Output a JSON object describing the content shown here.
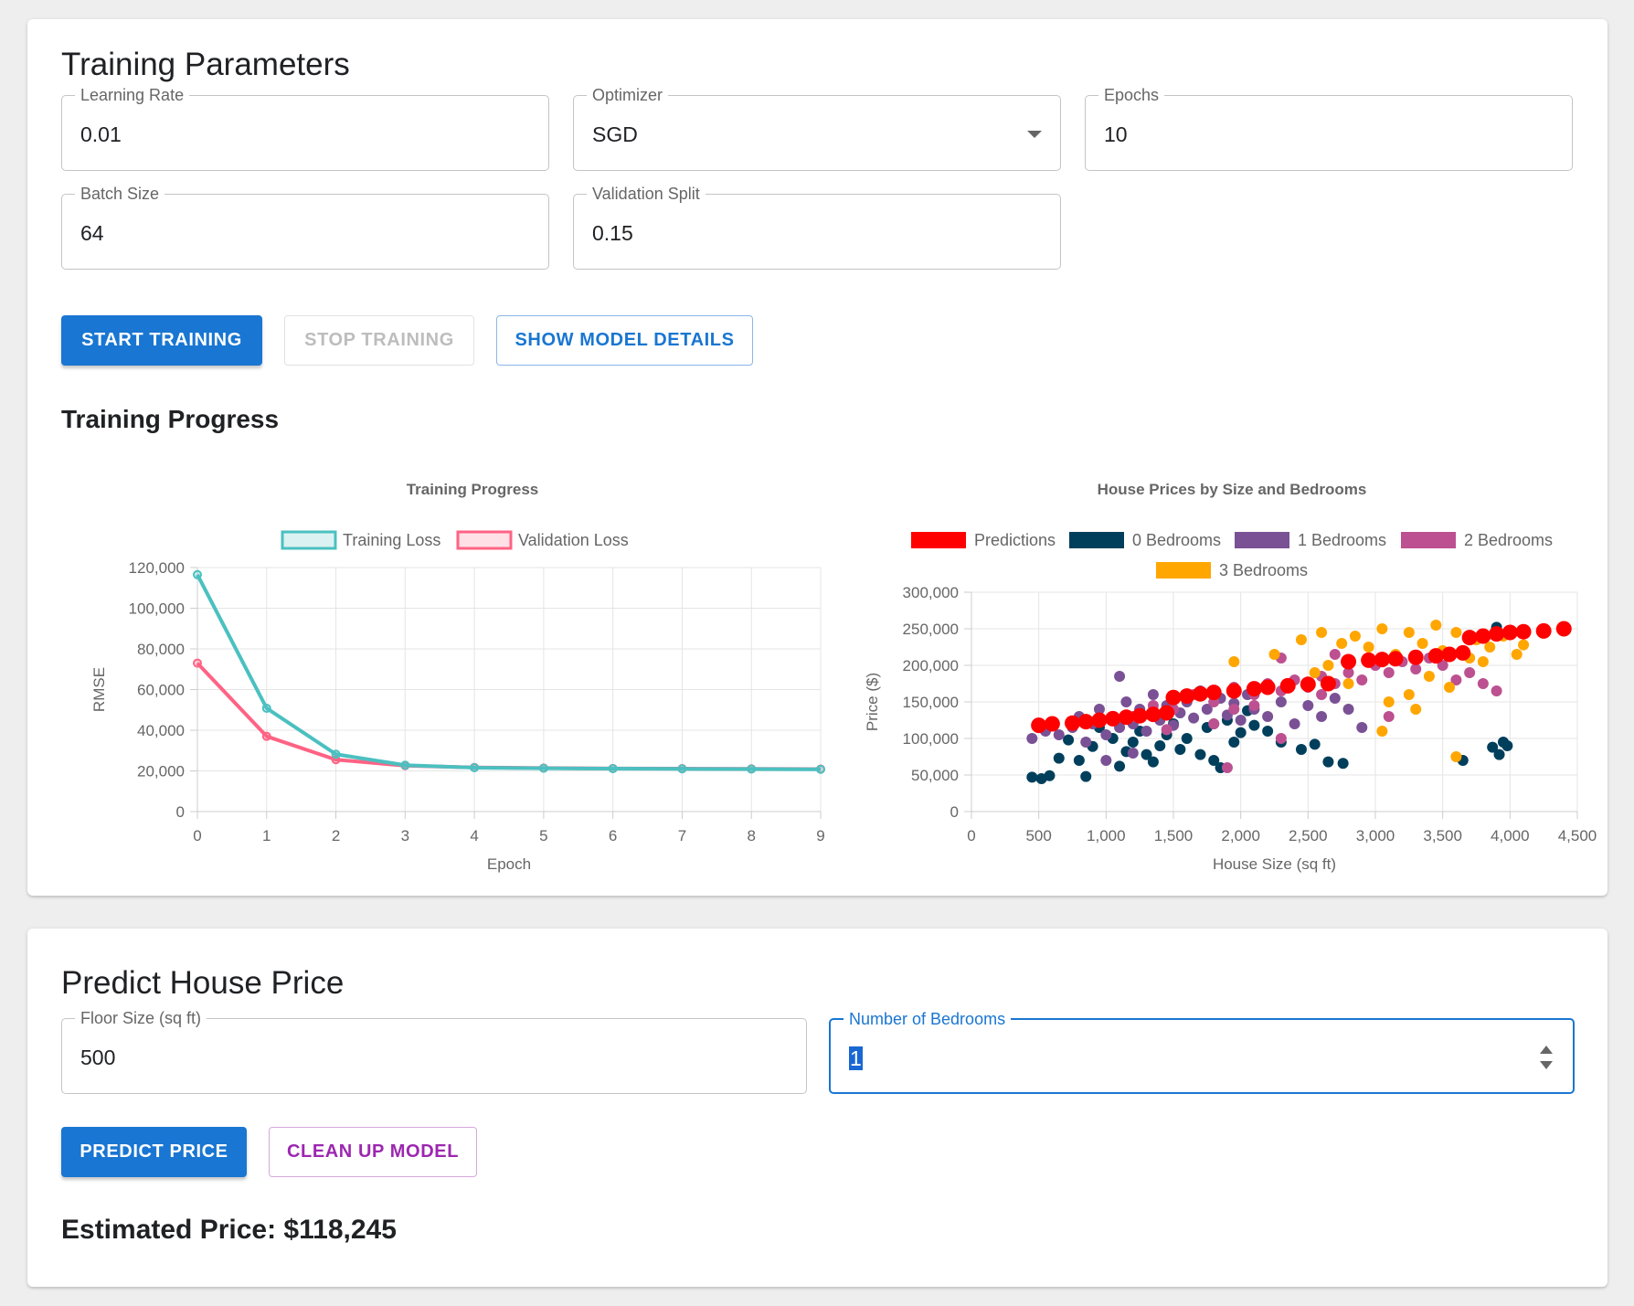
{
  "training": {
    "title": "Training Parameters",
    "fields": {
      "learning_rate": {
        "label": "Learning Rate",
        "value": "0.01"
      },
      "optimizer": {
        "label": "Optimizer",
        "value": "SGD"
      },
      "epochs": {
        "label": "Epochs",
        "value": "10"
      },
      "batch_size": {
        "label": "Batch Size",
        "value": "64"
      },
      "validation_split": {
        "label": "Validation Split",
        "value": "0.15"
      }
    },
    "buttons": {
      "start": "Start Training",
      "stop": "Stop Training",
      "details": "Show Model Details"
    },
    "progress_title": "Training Progress"
  },
  "predict": {
    "title": "Predict House Price",
    "floor_size": {
      "label": "Floor Size (sq ft)",
      "value": "500"
    },
    "bedrooms": {
      "label": "Number of Bedrooms",
      "value": "1"
    },
    "buttons": {
      "predict": "Predict Price",
      "cleanup": "Clean Up Model"
    },
    "estimate_text": "Estimated Price: $118,245"
  },
  "colors": {
    "primary": "#1976d2",
    "secondary": "#9c27b0",
    "training_loss": "#4bc0c0",
    "validation_loss": "#ff6384",
    "predictions": "#ff0000",
    "bed0": "#003f5c",
    "bed1": "#7a5195",
    "bed2": "#bc5090",
    "bed3": "#ffa600"
  },
  "chart_data": [
    {
      "type": "line",
      "title": "Training Progress",
      "xlabel": "Epoch",
      "ylabel": "RMSE",
      "x": [
        0,
        1,
        2,
        3,
        4,
        5,
        6,
        7,
        8,
        9
      ],
      "series": [
        {
          "name": "Training Loss",
          "values": [
            116500,
            50800,
            28200,
            22800,
            21600,
            21300,
            21100,
            21000,
            20900,
            20800
          ]
        },
        {
          "name": "Validation Loss",
          "values": [
            73000,
            37000,
            25500,
            22600,
            21700,
            21400,
            21200,
            21100,
            21000,
            20900
          ]
        }
      ],
      "xlim": [
        0,
        9
      ],
      "ylim": [
        0,
        120000
      ],
      "yticks": [
        "0",
        "20,000",
        "40,000",
        "60,000",
        "80,000",
        "100,000",
        "120,000"
      ],
      "xticks": [
        "0",
        "1",
        "2",
        "3",
        "4",
        "5",
        "6",
        "7",
        "8",
        "9"
      ],
      "grid": true,
      "legend": "top"
    },
    {
      "type": "scatter",
      "title": "House Prices by Size and Bedrooms",
      "xlabel": "House Size (sq ft)",
      "ylabel": "Price ($)",
      "xlim": [
        0,
        4500
      ],
      "ylim": [
        0,
        300000
      ],
      "xticks": [
        "0",
        "500",
        "1,000",
        "1,500",
        "2,000",
        "2,500",
        "3,000",
        "3,500",
        "4,000",
        "4,500"
      ],
      "yticks": [
        "0",
        "50,000",
        "100,000",
        "150,000",
        "200,000",
        "250,000",
        "300,000"
      ],
      "grid": true,
      "legend": "top",
      "series": [
        {
          "name": "Predictions",
          "points": [
            [
              500,
              118000
            ],
            [
              600,
              120000
            ],
            [
              750,
              121000
            ],
            [
              850,
              123000
            ],
            [
              950,
              125000
            ],
            [
              1050,
              127000
            ],
            [
              1150,
              129000
            ],
            [
              1250,
              131000
            ],
            [
              1350,
              133000
            ],
            [
              1450,
              135000
            ],
            [
              1500,
              156000
            ],
            [
              1600,
              158000
            ],
            [
              1700,
              161000
            ],
            [
              1800,
              163000
            ],
            [
              1950,
              165000
            ],
            [
              2100,
              168000
            ],
            [
              2200,
              170000
            ],
            [
              2350,
              172000
            ],
            [
              2500,
              174000
            ],
            [
              2650,
              175000
            ],
            [
              2800,
              205000
            ],
            [
              2950,
              207000
            ],
            [
              3050,
              208000
            ],
            [
              3150,
              209000
            ],
            [
              3300,
              211000
            ],
            [
              3450,
              213000
            ],
            [
              3550,
              215000
            ],
            [
              3650,
              217000
            ],
            [
              3700,
              238000
            ],
            [
              3800,
              240000
            ],
            [
              3900,
              243000
            ],
            [
              4000,
              245000
            ],
            [
              4100,
              246000
            ],
            [
              4250,
              247000
            ],
            [
              4400,
              250000
            ]
          ]
        },
        {
          "name": "0 Bedrooms",
          "points": [
            [
              450,
              47000
            ],
            [
              520,
              45000
            ],
            [
              580,
              49000
            ],
            [
              650,
              73000
            ],
            [
              720,
              98000
            ],
            [
              800,
              70000
            ],
            [
              850,
              48000
            ],
            [
              900,
              89000
            ],
            [
              950,
              115000
            ],
            [
              1050,
              100000
            ],
            [
              1100,
              62000
            ],
            [
              1150,
              82000
            ],
            [
              1200,
              95000
            ],
            [
              1250,
              110000
            ],
            [
              1300,
              78000
            ],
            [
              1350,
              68000
            ],
            [
              1400,
              90000
            ],
            [
              1450,
              105000
            ],
            [
              1500,
              120000
            ],
            [
              1550,
              85000
            ],
            [
              1600,
              100000
            ],
            [
              1700,
              78000
            ],
            [
              1750,
              115000
            ],
            [
              1800,
              70000
            ],
            [
              1850,
              60000
            ],
            [
              1900,
              125000
            ],
            [
              1950,
              95000
            ],
            [
              2000,
              108000
            ],
            [
              2050,
              138000
            ],
            [
              2100,
              118000
            ],
            [
              2200,
              110000
            ],
            [
              2300,
              95000
            ],
            [
              2450,
              85000
            ],
            [
              2550,
              92000
            ],
            [
              2650,
              68000
            ],
            [
              2760,
              66000
            ],
            [
              3650,
              70000
            ],
            [
              3870,
              88000
            ],
            [
              3920,
              78000
            ],
            [
              3950,
              95000
            ],
            [
              3980,
              90000
            ],
            [
              3900,
              252000
            ]
          ]
        },
        {
          "name": "1 Bedrooms",
          "points": [
            [
              450,
              100000
            ],
            [
              550,
              110000
            ],
            [
              650,
              105000
            ],
            [
              750,
              115000
            ],
            [
              800,
              130000
            ],
            [
              850,
              95000
            ],
            [
              900,
              120000
            ],
            [
              950,
              140000
            ],
            [
              1000,
              105000
            ],
            [
              1050,
              130000
            ],
            [
              1100,
              115000
            ],
            [
              1150,
              150000
            ],
            [
              1200,
              120000
            ],
            [
              1250,
              140000
            ],
            [
              1300,
              110000
            ],
            [
              1350,
              160000
            ],
            [
              1400,
              125000
            ],
            [
              1450,
              145000
            ],
            [
              1500,
              118000
            ],
            [
              1550,
              135000
            ],
            [
              1600,
              150000
            ],
            [
              1650,
              128000
            ],
            [
              1700,
              165000
            ],
            [
              1750,
              140000
            ],
            [
              1800,
              120000
            ],
            [
              1850,
              155000
            ],
            [
              1900,
              132000
            ],
            [
              1950,
              148000
            ],
            [
              2000,
              125000
            ],
            [
              2050,
              160000
            ],
            [
              2100,
              140000
            ],
            [
              2200,
              130000
            ],
            [
              2300,
              150000
            ],
            [
              2400,
              120000
            ],
            [
              2500,
              145000
            ],
            [
              2600,
              130000
            ],
            [
              2800,
              140000
            ],
            [
              1100,
              185000
            ],
            [
              1000,
              70000
            ],
            [
              1200,
              80000
            ],
            [
              2700,
              155000
            ],
            [
              2900,
              115000
            ]
          ]
        },
        {
          "name": "2 Bedrooms",
          "points": [
            [
              1200,
              130000
            ],
            [
              1350,
              145000
            ],
            [
              1500,
              140000
            ],
            [
              1650,
              160000
            ],
            [
              1800,
              150000
            ],
            [
              1950,
              170000
            ],
            [
              2100,
              160000
            ],
            [
              2200,
              175000
            ],
            [
              2300,
              165000
            ],
            [
              2400,
              180000
            ],
            [
              2500,
              170000
            ],
            [
              2600,
              185000
            ],
            [
              2700,
              175000
            ],
            [
              2800,
              190000
            ],
            [
              2900,
              180000
            ],
            [
              3000,
              200000
            ],
            [
              3100,
              190000
            ],
            [
              3200,
              205000
            ],
            [
              3300,
              195000
            ],
            [
              3400,
              210000
            ],
            [
              3500,
              200000
            ],
            [
              3600,
              180000
            ],
            [
              3700,
              190000
            ],
            [
              3800,
              175000
            ],
            [
              3900,
              165000
            ],
            [
              2700,
              215000
            ],
            [
              2300,
              210000
            ],
            [
              1950,
              140000
            ],
            [
              2100,
              145000
            ],
            [
              1800,
              120000
            ],
            [
              1450,
              112000
            ],
            [
              1900,
              60000
            ],
            [
              2300,
              100000
            ],
            [
              2600,
              160000
            ],
            [
              3100,
              130000
            ]
          ]
        },
        {
          "name": "3 Bedrooms",
          "points": [
            [
              1950,
              205000
            ],
            [
              2250,
              215000
            ],
            [
              2450,
              235000
            ],
            [
              2600,
              245000
            ],
            [
              2750,
              230000
            ],
            [
              2850,
              240000
            ],
            [
              2950,
              225000
            ],
            [
              3050,
              250000
            ],
            [
              3150,
              215000
            ],
            [
              3250,
              245000
            ],
            [
              3350,
              230000
            ],
            [
              3450,
              255000
            ],
            [
              3500,
              220000
            ],
            [
              3600,
              245000
            ],
            [
              3700,
              210000
            ],
            [
              3750,
              235000
            ],
            [
              3850,
              225000
            ],
            [
              3950,
              240000
            ],
            [
              4050,
              215000
            ],
            [
              4100,
              228000
            ],
            [
              3400,
              185000
            ],
            [
              3250,
              160000
            ],
            [
              3100,
              150000
            ],
            [
              3300,
              140000
            ],
            [
              3050,
              110000
            ],
            [
              3600,
              75000
            ],
            [
              2800,
              175000
            ],
            [
              2550,
              190000
            ],
            [
              3550,
              170000
            ],
            [
              3800,
              205000
            ],
            [
              2650,
              200000
            ]
          ]
        }
      ]
    }
  ]
}
